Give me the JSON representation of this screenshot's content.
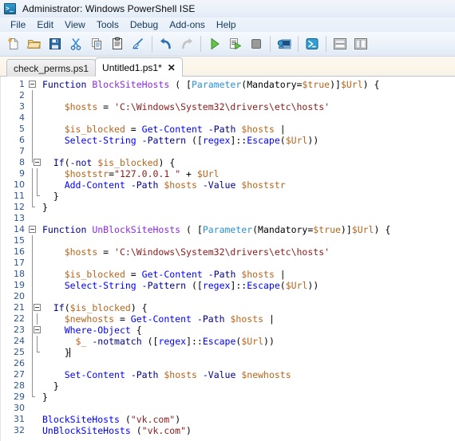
{
  "window": {
    "title": "Administrator: Windows PowerShell ISE",
    "icon": "powershell-ise-icon"
  },
  "menubar": {
    "items": [
      {
        "label": "File",
        "name": "menu-file"
      },
      {
        "label": "Edit",
        "name": "menu-edit"
      },
      {
        "label": "View",
        "name": "menu-view"
      },
      {
        "label": "Tools",
        "name": "menu-tools"
      },
      {
        "label": "Debug",
        "name": "menu-debug"
      },
      {
        "label": "Add-ons",
        "name": "menu-add-ons"
      },
      {
        "label": "Help",
        "name": "menu-help"
      }
    ]
  },
  "toolbar": {
    "buttons": [
      {
        "icon": "new-file-icon",
        "name": "new-script-button"
      },
      {
        "icon": "open-folder-icon",
        "name": "open-script-button"
      },
      {
        "icon": "save-icon",
        "name": "save-button"
      },
      {
        "icon": "scissors-icon",
        "name": "cut-button"
      },
      {
        "icon": "copy-icon",
        "name": "copy-button"
      },
      {
        "icon": "clipboard-icon",
        "name": "paste-button"
      },
      {
        "icon": "clear-icon",
        "name": "clear-console-button"
      },
      {
        "icon": "undo-arrow-icon",
        "name": "undo-button"
      },
      {
        "icon": "redo-arrow-icon",
        "name": "redo-button"
      },
      {
        "icon": "play-triangle-icon",
        "name": "run-script-button"
      },
      {
        "icon": "run-selection-icon",
        "name": "run-selection-button"
      },
      {
        "icon": "stop-square-icon",
        "name": "stop-operation-button"
      },
      {
        "icon": "remote-computer-icon",
        "name": "new-remote-tab-button"
      },
      {
        "icon": "powershell-tab-icon",
        "name": "start-powershell-button"
      },
      {
        "icon": "layout-horizontal-icon",
        "name": "show-script-pane-top-button"
      },
      {
        "icon": "layout-vertical-icon",
        "name": "show-script-pane-right-button"
      }
    ]
  },
  "tabs": [
    {
      "label": "check_perms.ps1",
      "active": false,
      "closable": false,
      "name": "tab-check-perms"
    },
    {
      "label": "Untitled1.ps1*",
      "active": true,
      "closable": true,
      "close_glyph": "✕",
      "name": "tab-untitled1"
    }
  ],
  "editor": {
    "line_count": 32,
    "colors": {
      "keyword": "#00008b",
      "cmdlet": "#0000ff",
      "function_name": "#8a2be2",
      "variable": "#b5651d",
      "string": "#8b1a1a",
      "type": "#2b91d6",
      "line_number": "#2b5797"
    },
    "lines": [
      {
        "n": 1,
        "text": "Function BlockSiteHosts ( [Parameter(Mandatory=$true)]$Url) {"
      },
      {
        "n": 2,
        "text": ""
      },
      {
        "n": 3,
        "text": "    $hosts = 'C:\\Windows\\System32\\drivers\\etc\\hosts'"
      },
      {
        "n": 4,
        "text": ""
      },
      {
        "n": 5,
        "text": "    $is_blocked = Get-Content -Path $hosts |"
      },
      {
        "n": 6,
        "text": "    Select-String -Pattern ([regex]::Escape($Url))"
      },
      {
        "n": 7,
        "text": ""
      },
      {
        "n": 8,
        "text": "    If(-not $is_blocked) {"
      },
      {
        "n": 9,
        "text": "        $hoststr=\"127.0.0.1 \" + $Url"
      },
      {
        "n": 10,
        "text": "        Add-Content -Path $hosts -Value $hoststr"
      },
      {
        "n": 11,
        "text": "    }"
      },
      {
        "n": 12,
        "text": "  }"
      },
      {
        "n": 13,
        "text": ""
      },
      {
        "n": 14,
        "text": "Function UnBlockSiteHosts ( [Parameter(Mandatory=$true)]$Url) {"
      },
      {
        "n": 15,
        "text": ""
      },
      {
        "n": 16,
        "text": "    $hosts = 'C:\\Windows\\System32\\drivers\\etc\\hosts'"
      },
      {
        "n": 17,
        "text": ""
      },
      {
        "n": 18,
        "text": "    $is_blocked = Get-Content -Path $hosts |"
      },
      {
        "n": 19,
        "text": "    Select-String -Pattern ([regex]::Escape($Url))"
      },
      {
        "n": 20,
        "text": ""
      },
      {
        "n": 21,
        "text": "    If($is_blocked) {"
      },
      {
        "n": 22,
        "text": "        $newhosts = Get-Content -Path $hosts |"
      },
      {
        "n": 23,
        "text": "        Where-Object {"
      },
      {
        "n": 24,
        "text": "            $_ -notmatch ([regex]::Escape($Url))"
      },
      {
        "n": 25,
        "text": "        }"
      },
      {
        "n": 26,
        "text": ""
      },
      {
        "n": 27,
        "text": "        Set-Content -Path $hosts -Value $newhosts"
      },
      {
        "n": 28,
        "text": "    }"
      },
      {
        "n": 29,
        "text": "}"
      },
      {
        "n": 30,
        "text": ""
      },
      {
        "n": 31,
        "text": "BlockSiteHosts (\"vk.com\")"
      },
      {
        "n": 32,
        "text": "UnBlockSiteHosts (\"vk.com\")"
      }
    ]
  }
}
